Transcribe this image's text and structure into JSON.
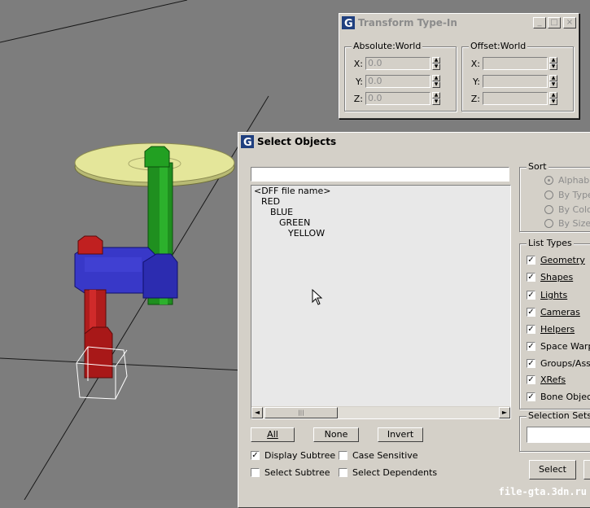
{
  "transform_dialog": {
    "title": "Transform Type-In",
    "absolute": {
      "label": "Absolute:World",
      "rows": [
        {
          "axis": "X:",
          "value": "0.0"
        },
        {
          "axis": "Y:",
          "value": "0.0"
        },
        {
          "axis": "Z:",
          "value": "0.0"
        }
      ]
    },
    "offset": {
      "label": "Offset:World",
      "rows": [
        {
          "axis": "X:",
          "value": ""
        },
        {
          "axis": "Y:",
          "value": ""
        },
        {
          "axis": "Z:",
          "value": ""
        }
      ]
    }
  },
  "select_dialog": {
    "title": "Select Objects",
    "search_value": "",
    "tree": [
      "<DFF file name>",
      "RED",
      "BLUE",
      "GREEN",
      "YELLOW"
    ],
    "buttons": {
      "all": "All",
      "none": "None",
      "invert": "Invert",
      "select": "Select"
    },
    "options": {
      "display_subtree": {
        "label": "Display Subtree",
        "checked": true
      },
      "case_sensitive": {
        "label": "Case Sensitive",
        "checked": false
      },
      "select_subtree": {
        "label": "Select Subtree",
        "checked": false
      },
      "select_dependents": {
        "label": "Select Dependents",
        "checked": false
      }
    },
    "sort": {
      "label": "Sort",
      "options": [
        "Alphabetical",
        "By Type",
        "By Color",
        "By Size"
      ]
    },
    "list_types": {
      "label": "List Types",
      "items": [
        "Geometry",
        "Shapes",
        "Lights",
        "Cameras",
        "Helpers",
        "Space Warps",
        "Groups/Assembly",
        "XRefs",
        "Bone Objects"
      ]
    },
    "selection_sets_label": "Selection Sets"
  },
  "watermark": "file-gta.3dn.ru",
  "colors": {
    "dialog_bg": "#d4d0c8",
    "viewport_bg": "#7d7d7d",
    "disabled_text": "#8c8c8c"
  }
}
